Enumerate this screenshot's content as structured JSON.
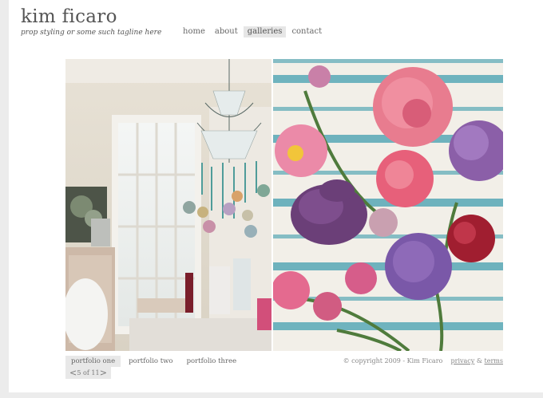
{
  "site": {
    "title": "kim ficaro",
    "tagline": "prop styling or some such tagline here"
  },
  "nav": {
    "items": [
      {
        "label": "home"
      },
      {
        "label": "about"
      },
      {
        "label": "galleries",
        "active": true
      },
      {
        "label": "contact"
      }
    ]
  },
  "gallery": {
    "tabs": [
      {
        "label": "portfolio one",
        "active": true
      },
      {
        "label": "portfolio two"
      },
      {
        "label": "portfolio three"
      }
    ],
    "pager": {
      "prev": "<",
      "next": ">",
      "count": "5 of 11"
    }
  },
  "footer": {
    "copyright": "© copyright 2009 - Kim Ficaro",
    "privacy": "privacy",
    "amp": "&",
    "terms": "terms"
  },
  "colors": {
    "background": "#ffffff",
    "sidebar": "#ececec",
    "active_tab": "#e6e6e6",
    "text": "#555555"
  }
}
